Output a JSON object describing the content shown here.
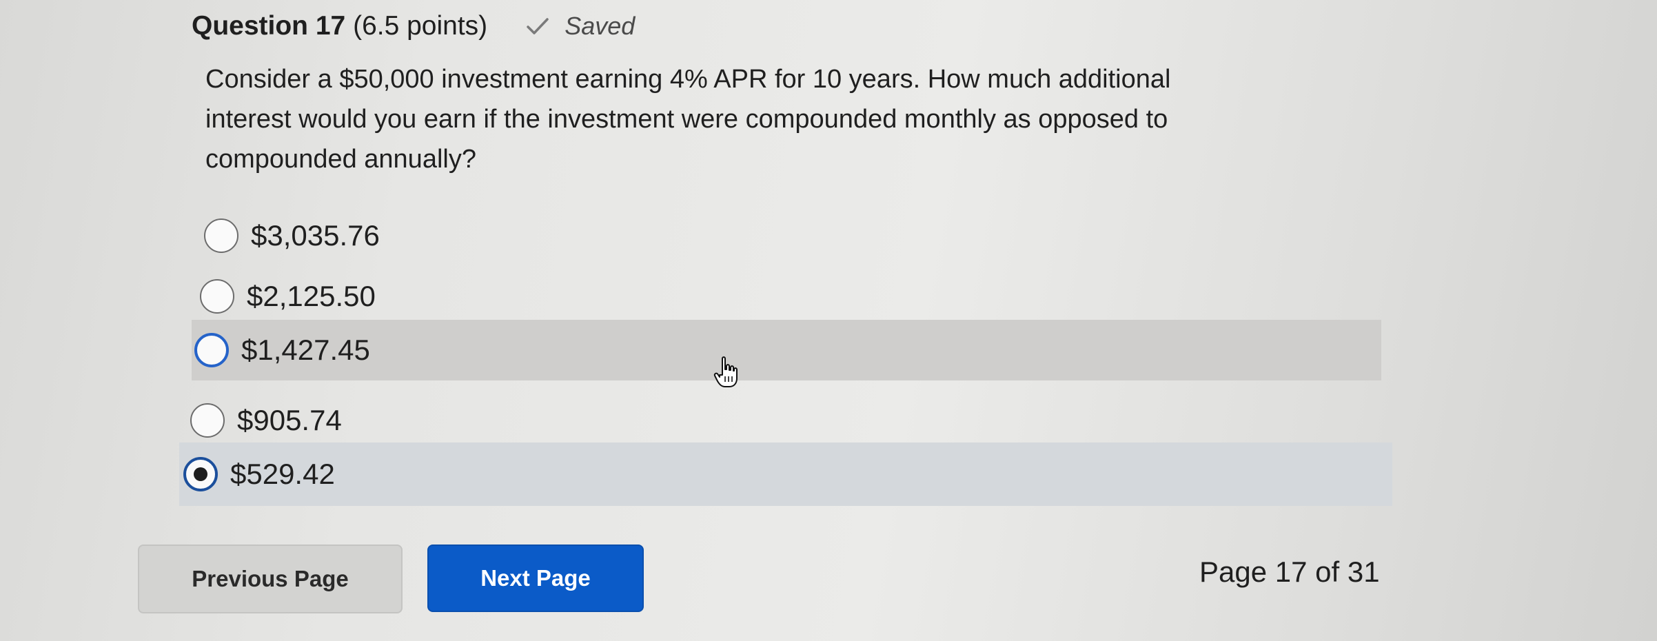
{
  "header": {
    "question_label": "Question 17",
    "points": "(6.5 points)",
    "status": "Saved",
    "status_icon": "check-icon"
  },
  "question": {
    "line1": "Consider a $50,000 investment earning 4% APR for 10 years. How much additional",
    "line2": "interest would you earn if the investment were compounded monthly as opposed to",
    "line3": "compounded annually?"
  },
  "options": [
    {
      "label": "$3,035.76",
      "selected": false
    },
    {
      "label": "$2,125.50",
      "selected": false
    },
    {
      "label": "$1,427.45",
      "selected": false,
      "hovered": true
    },
    {
      "label": "$905.74",
      "selected": false
    },
    {
      "label": "$529.42",
      "selected": true
    }
  ],
  "navigation": {
    "previous_label": "Previous Page",
    "next_label": "Next Page",
    "page_indicator": "Page 17 of 31"
  },
  "colors": {
    "accent": "#0b5bc8",
    "hover_row": "#cfcecc",
    "selected_row": "#d4d8dc"
  },
  "cursor_icon": "hand-pointer-icon"
}
